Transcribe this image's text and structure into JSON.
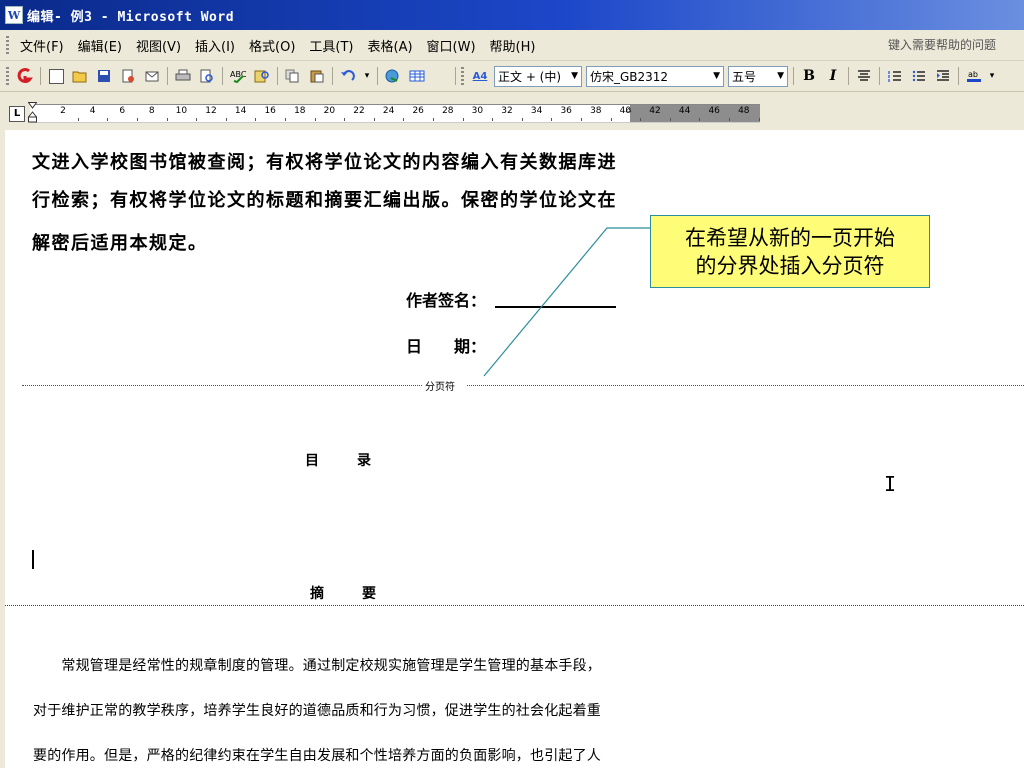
{
  "window": {
    "title": "编辑- 例3 - Microsoft Word",
    "app_icon": "word-icon"
  },
  "menu": {
    "items": [
      "文件(F)",
      "编辑(E)",
      "视图(V)",
      "插入(I)",
      "格式(O)",
      "工具(T)",
      "表格(A)",
      "窗口(W)",
      "帮助(H)"
    ],
    "help_placeholder": "键入需要帮助的问题"
  },
  "toolbar": {
    "style_value": "正文 + (中)",
    "font_value": "仿宋_GB2312",
    "size_value": "五号",
    "bold_label": "B",
    "italic_label": "I",
    "style_marker": "A4",
    "icons": [
      "new-icon",
      "open-icon",
      "save-icon",
      "permission-icon",
      "email-icon",
      "print-icon",
      "print-preview-icon",
      "spelling-icon",
      "research-icon",
      "copy-icon",
      "paste-icon",
      "undo-icon",
      "hyperlink-icon",
      "table-icon",
      "align-center-icon",
      "numbering-icon",
      "bullets-icon",
      "indent-icon",
      "highlight-icon"
    ],
    "accent_colors": {
      "office_logo": "#d31f26",
      "highlight": "#1c47c9"
    }
  },
  "ruler": {
    "numbers": [
      "2",
      "4",
      "6",
      "8",
      "10",
      "12",
      "14",
      "16",
      "18",
      "20",
      "22",
      "24",
      "26",
      "28",
      "30",
      "32",
      "34",
      "36",
      "38",
      "40",
      "42",
      "44",
      "46",
      "48"
    ],
    "corner_label": "L"
  },
  "document": {
    "paragraph_lines": [
      "文进入学校图书馆被查阅；有权将学位论文的内容编入有关数据库进",
      "行检索；有权将学位论文的标题和摘要汇编出版。保密的学位论文在",
      "解密后适用本规定。"
    ],
    "author_label": "作者签名：",
    "date_label": "日　　期：",
    "page_break_label": "分页符",
    "toc_heading": "目　录",
    "abstract_heading": "摘　要",
    "body_lines": [
      "　　常规管理是经常性的规章制度的管理。通过制定校规实施管理是学生管理的基本手段，",
      "对于维护正常的教学秩序，培养学生良好的道德品质和行为习惯，促进学生的社会化起着重",
      "要的作用。但是，严格的纪律约束在学生自由发展和个性培养方面的负面影响，也引起了人"
    ]
  },
  "callout": {
    "lines": [
      "在希望从新的一页开始",
      "的分界处插入分页符"
    ],
    "bg_color": "#fffd78",
    "border_color": "#2b8e9c"
  }
}
